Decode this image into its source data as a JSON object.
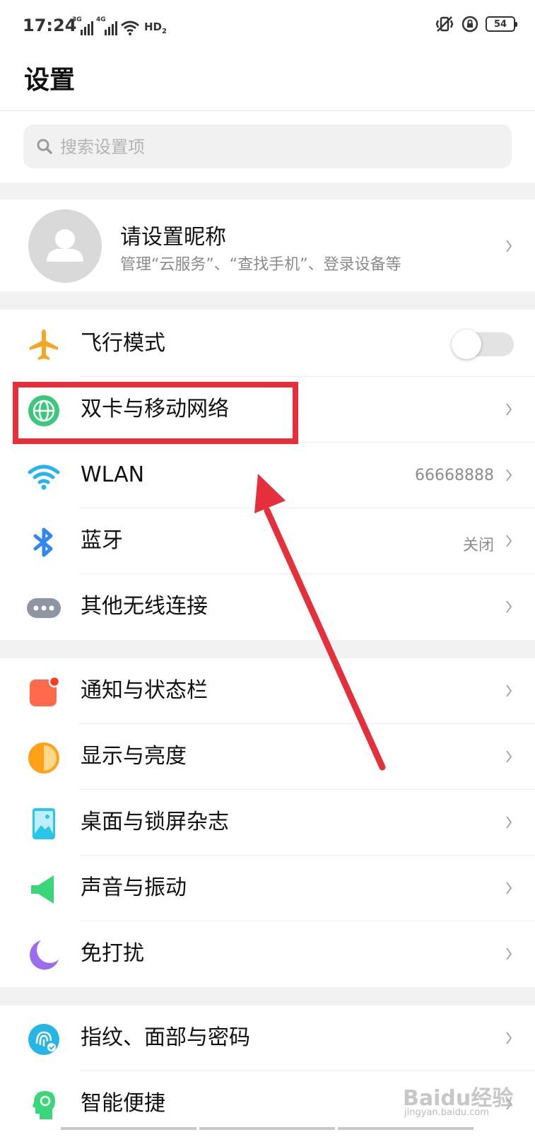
{
  "status_bar": {
    "time": "17:24",
    "network_1": "3G",
    "network_2": "4G",
    "hd_label": "HD",
    "hd_sub": "2",
    "battery": "54",
    "icons": [
      "signal-icon",
      "signal-icon",
      "wifi-icon",
      "vibrate-icon",
      "rotation-lock-icon",
      "battery-icon"
    ]
  },
  "page": {
    "title": "设置"
  },
  "search": {
    "placeholder": "搜索设置项"
  },
  "profile": {
    "name": "请设置昵称",
    "subtitle": "管理“云服务”、“查找手机”、登录设备等"
  },
  "sections": [
    {
      "items": [
        {
          "label": "飞行模式",
          "icon": "airplane-icon",
          "toggle_on": false
        },
        {
          "label": "双卡与移动网络",
          "icon": "globe-icon"
        },
        {
          "label": "WLAN",
          "icon": "wifi-icon",
          "value": "66668888"
        },
        {
          "label": "蓝牙",
          "icon": "bluetooth-icon",
          "value": "关闭"
        },
        {
          "label": "其他无线连接",
          "icon": "more-icon"
        }
      ]
    },
    {
      "items": [
        {
          "label": "通知与状态栏",
          "icon": "notification-icon"
        },
        {
          "label": "显示与亮度",
          "icon": "brightness-icon"
        },
        {
          "label": "桌面与锁屏杂志",
          "icon": "wallpaper-icon"
        },
        {
          "label": "声音与振动",
          "icon": "speaker-icon"
        },
        {
          "label": "免打扰",
          "icon": "moon-icon"
        }
      ]
    },
    {
      "items": [
        {
          "label": "指纹、面部与密码",
          "icon": "fingerprint-icon"
        },
        {
          "label": "智能便捷",
          "icon": "smart-assist-icon"
        }
      ]
    }
  ],
  "watermark": {
    "text": "Baidu经验",
    "sub": "jingyan.baidu.com"
  },
  "colors": {
    "annotation": "#e5303b",
    "airplane": "#f5a623",
    "globe": "#3cc87a",
    "wifi": "#27b2f0",
    "bluetooth": "#2f86f6",
    "notification": "#ff6a4d",
    "brightness": "#ffa21a",
    "moon": "#9b6cf0"
  }
}
